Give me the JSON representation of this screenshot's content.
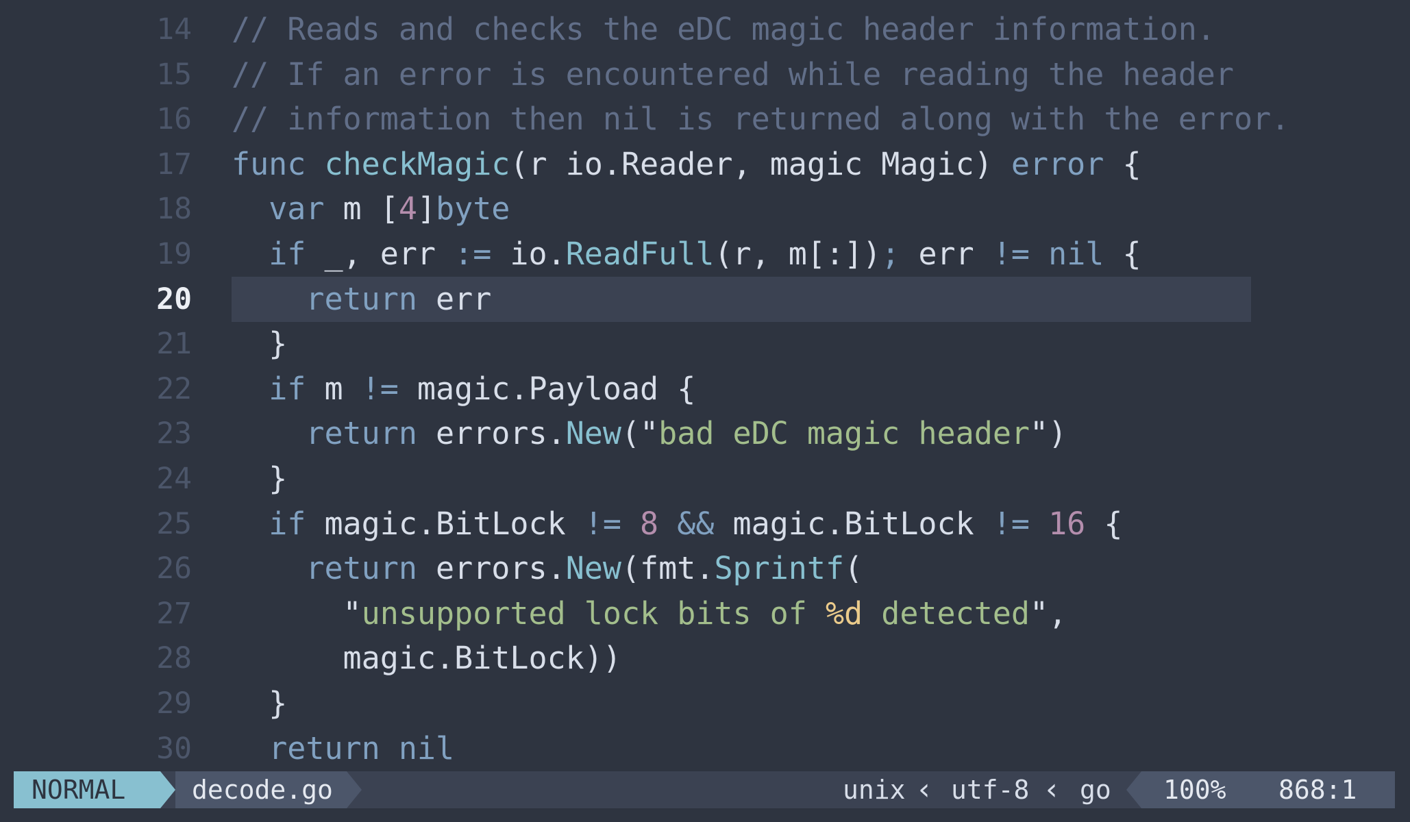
{
  "editor": {
    "lines": [
      {
        "number": "14",
        "current": false,
        "tokens": [
          {
            "t": "comment",
            "v": "// Reads and checks the eDC magic header information."
          }
        ]
      },
      {
        "number": "15",
        "current": false,
        "tokens": [
          {
            "t": "comment",
            "v": "// If an error is encountered while reading the header"
          }
        ]
      },
      {
        "number": "16",
        "current": false,
        "tokens": [
          {
            "t": "comment",
            "v": "// information then nil is returned along with the error."
          }
        ]
      },
      {
        "number": "17",
        "current": false,
        "tokens": [
          {
            "t": "keyword",
            "v": "func"
          },
          {
            "t": "plain",
            "v": " "
          },
          {
            "t": "func",
            "v": "checkMagic"
          },
          {
            "t": "plain",
            "v": "(r io.Reader, magic Magic) "
          },
          {
            "t": "type",
            "v": "error"
          },
          {
            "t": "plain",
            "v": " {"
          }
        ]
      },
      {
        "number": "18",
        "current": false,
        "tokens": [
          {
            "t": "plain",
            "v": "  "
          },
          {
            "t": "keyword",
            "v": "var"
          },
          {
            "t": "plain",
            "v": " m ["
          },
          {
            "t": "number",
            "v": "4"
          },
          {
            "t": "plain",
            "v": "]"
          },
          {
            "t": "type",
            "v": "byte"
          }
        ]
      },
      {
        "number": "19",
        "current": false,
        "tokens": [
          {
            "t": "plain",
            "v": "  "
          },
          {
            "t": "keyword",
            "v": "if"
          },
          {
            "t": "plain",
            "v": " _, err "
          },
          {
            "t": "operator",
            "v": ":="
          },
          {
            "t": "plain",
            "v": " io."
          },
          {
            "t": "func",
            "v": "ReadFull"
          },
          {
            "t": "plain",
            "v": "(r, m[:])"
          },
          {
            "t": "operator",
            "v": ";"
          },
          {
            "t": "plain",
            "v": " err "
          },
          {
            "t": "operator",
            "v": "!="
          },
          {
            "t": "plain",
            "v": " "
          },
          {
            "t": "keyword",
            "v": "nil"
          },
          {
            "t": "plain",
            "v": " {"
          }
        ]
      },
      {
        "number": "20",
        "current": true,
        "tokens": [
          {
            "t": "plain",
            "v": "    "
          },
          {
            "t": "keyword",
            "v": "return"
          },
          {
            "t": "plain",
            "v": " err"
          }
        ]
      },
      {
        "number": "21",
        "current": false,
        "tokens": [
          {
            "t": "plain",
            "v": "  }"
          }
        ]
      },
      {
        "number": "22",
        "current": false,
        "tokens": [
          {
            "t": "plain",
            "v": "  "
          },
          {
            "t": "keyword",
            "v": "if"
          },
          {
            "t": "plain",
            "v": " m "
          },
          {
            "t": "operator",
            "v": "!="
          },
          {
            "t": "plain",
            "v": " magic.Payload {"
          }
        ]
      },
      {
        "number": "23",
        "current": false,
        "tokens": [
          {
            "t": "plain",
            "v": "    "
          },
          {
            "t": "keyword",
            "v": "return"
          },
          {
            "t": "plain",
            "v": " errors."
          },
          {
            "t": "func",
            "v": "New"
          },
          {
            "t": "plain",
            "v": "(\""
          },
          {
            "t": "string",
            "v": "bad eDC magic header"
          },
          {
            "t": "plain",
            "v": "\")"
          }
        ]
      },
      {
        "number": "24",
        "current": false,
        "tokens": [
          {
            "t": "plain",
            "v": "  }"
          }
        ]
      },
      {
        "number": "25",
        "current": false,
        "tokens": [
          {
            "t": "plain",
            "v": "  "
          },
          {
            "t": "keyword",
            "v": "if"
          },
          {
            "t": "plain",
            "v": " magic.BitLock "
          },
          {
            "t": "operator",
            "v": "!="
          },
          {
            "t": "plain",
            "v": " "
          },
          {
            "t": "number",
            "v": "8"
          },
          {
            "t": "plain",
            "v": " "
          },
          {
            "t": "operator",
            "v": "&&"
          },
          {
            "t": "plain",
            "v": " magic.BitLock "
          },
          {
            "t": "operator",
            "v": "!="
          },
          {
            "t": "plain",
            "v": " "
          },
          {
            "t": "number",
            "v": "16"
          },
          {
            "t": "plain",
            "v": " {"
          }
        ]
      },
      {
        "number": "26",
        "current": false,
        "tokens": [
          {
            "t": "plain",
            "v": "    "
          },
          {
            "t": "keyword",
            "v": "return"
          },
          {
            "t": "plain",
            "v": " errors."
          },
          {
            "t": "func",
            "v": "New"
          },
          {
            "t": "plain",
            "v": "(fmt."
          },
          {
            "t": "func",
            "v": "Sprintf"
          },
          {
            "t": "plain",
            "v": "("
          }
        ]
      },
      {
        "number": "27",
        "current": false,
        "tokens": [
          {
            "t": "plain",
            "v": "      \""
          },
          {
            "t": "string",
            "v": "unsupported lock bits of "
          },
          {
            "t": "format",
            "v": "%d"
          },
          {
            "t": "string",
            "v": " detected"
          },
          {
            "t": "plain",
            "v": "\","
          }
        ]
      },
      {
        "number": "28",
        "current": false,
        "tokens": [
          {
            "t": "plain",
            "v": "      magic.BitLock))"
          }
        ]
      },
      {
        "number": "29",
        "current": false,
        "tokens": [
          {
            "t": "plain",
            "v": "  }"
          }
        ]
      },
      {
        "number": "30",
        "current": false,
        "tokens": [
          {
            "t": "plain",
            "v": "  "
          },
          {
            "t": "keyword",
            "v": "return"
          },
          {
            "t": "plain",
            "v": " "
          },
          {
            "t": "keyword",
            "v": "nil"
          }
        ]
      }
    ]
  },
  "statusbar": {
    "mode": "NORMAL",
    "filename": "decode.go",
    "fileformat": "unix",
    "encoding": "utf-8",
    "filetype": "go",
    "percent": "100%",
    "cursor": "868:1"
  },
  "colors": {
    "background": "#2e3440",
    "comment": "#616e88",
    "keyword": "#81a1c1",
    "function": "#88c0d0",
    "string": "#a3be8c",
    "number": "#b48ead",
    "mode_bg": "#88c0d0"
  }
}
